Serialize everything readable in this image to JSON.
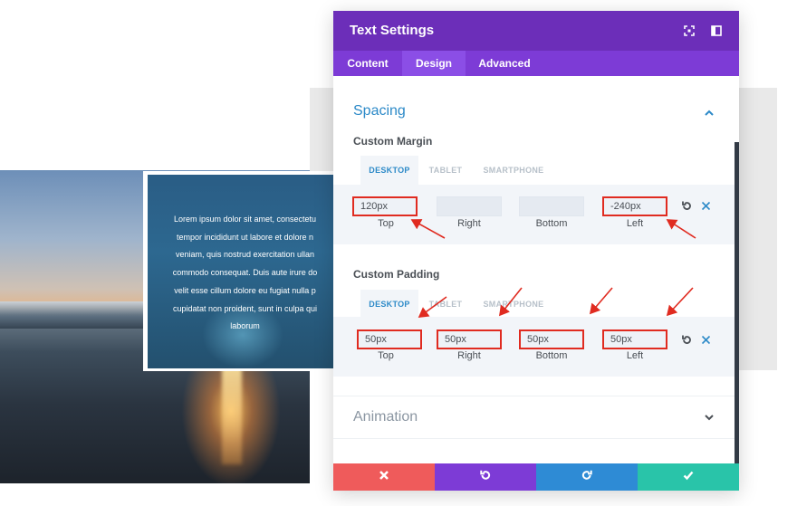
{
  "background": {
    "overlay_text_lines": [
      "Lorem ipsum dolor sit amet, consectetu",
      "tempor incididunt ut labore et dolore n",
      "veniam, quis nostrud exercitation ullan",
      "commodo consequat. Duis aute irure do",
      "velit esse cillum dolore eu fugiat nulla p",
      "cupidatat non proident, sunt in culpa qui",
      "laborum"
    ]
  },
  "modal": {
    "title": "Text Settings",
    "header_icons": [
      "expand-icon",
      "sidebar-toggle-icon"
    ],
    "tabs": [
      {
        "label": "Content",
        "active": false
      },
      {
        "label": "Design",
        "active": true
      },
      {
        "label": "Advanced",
        "active": false
      }
    ],
    "sections": {
      "spacing": {
        "title": "Spacing",
        "state": "expanded",
        "custom_margin": {
          "label": "Custom Margin",
          "device_tabs": [
            "DESKTOP",
            "TABLET",
            "SMARTPHONE"
          ],
          "active_device": "DESKTOP",
          "fields": [
            {
              "label": "Top",
              "value": "120px",
              "highlighted": true
            },
            {
              "label": "Right",
              "value": "",
              "highlighted": false
            },
            {
              "label": "Bottom",
              "value": "",
              "highlighted": false
            },
            {
              "label": "Left",
              "value": "-240px",
              "highlighted": true
            }
          ]
        },
        "custom_padding": {
          "label": "Custom Padding",
          "device_tabs": [
            "DESKTOP",
            "TABLET",
            "SMARTPHONE"
          ],
          "active_device": "DESKTOP",
          "fields": [
            {
              "label": "Top",
              "value": "50px",
              "highlighted": true
            },
            {
              "label": "Right",
              "value": "50px",
              "highlighted": true
            },
            {
              "label": "Bottom",
              "value": "50px",
              "highlighted": true
            },
            {
              "label": "Left",
              "value": "50px",
              "highlighted": true
            }
          ]
        }
      },
      "animation": {
        "title": "Animation",
        "state": "collapsed"
      }
    },
    "footer_buttons": [
      {
        "name": "discard",
        "icon": "close-icon",
        "color": "#ef5b5b"
      },
      {
        "name": "undo",
        "icon": "undo-icon",
        "color": "#7d3bd6"
      },
      {
        "name": "redo",
        "icon": "redo-icon",
        "color": "#2e8bd5"
      },
      {
        "name": "save",
        "icon": "check-icon",
        "color": "#29c4a9"
      }
    ]
  },
  "colors": {
    "header": "#6c2eb9",
    "tabs_bar": "#7d3bd6",
    "accent": "#2d8ac8",
    "highlight_box": "#e02b20"
  }
}
